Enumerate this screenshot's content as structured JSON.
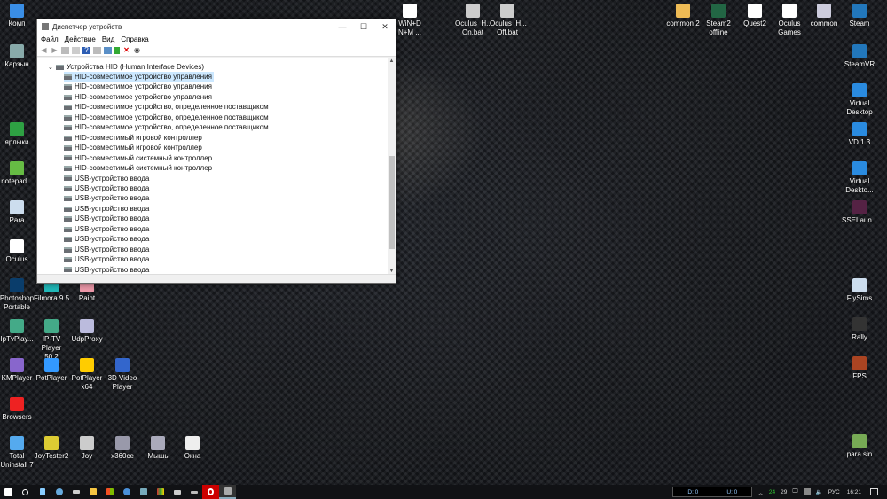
{
  "desktop": {
    "icons": [
      {
        "label": "Комп",
        "color": "#3a8ee6"
      },
      {
        "label": "Карзын",
        "color": "#8aa"
      },
      {
        "label": "ярлыки",
        "color": "#2ea043"
      },
      {
        "label": "notepad...",
        "color": "#6b4"
      },
      {
        "label": "Para",
        "color": "#cde"
      },
      {
        "label": "Oculus",
        "color": "#fff"
      },
      {
        "label": "Photoshop Portable",
        "color": "#0a3d6b"
      },
      {
        "label": "Filmora 9.5",
        "color": "#2bb"
      },
      {
        "label": "Paint",
        "color": "#e9a"
      },
      {
        "label": "IpTvPlay...",
        "color": "#4a8"
      },
      {
        "label": "IP-TV Player 50.2",
        "color": "#4a8"
      },
      {
        "label": "UdpProxy",
        "color": "#bbd"
      },
      {
        "label": "KMPlayer",
        "color": "#86c"
      },
      {
        "label": "PotPlayer",
        "color": "#39f"
      },
      {
        "label": "PotPlayer x64",
        "color": "#fc0"
      },
      {
        "label": "3D Video Player",
        "color": "#36c"
      },
      {
        "label": "Browsers",
        "color": "#e22"
      },
      {
        "label": "Total Uninstall 7",
        "color": "#5ae"
      },
      {
        "label": "JoyTester2",
        "color": "#dc3"
      },
      {
        "label": "Joy",
        "color": "#ccc"
      },
      {
        "label": "x360ce",
        "color": "#99a"
      },
      {
        "label": "Мышь",
        "color": "#aab"
      },
      {
        "label": "Окна",
        "color": "#eee"
      },
      {
        "label": "WiN+D N+M ...",
        "color": "#fff"
      },
      {
        "label": "Oculus_H... On.bat",
        "color": "#ccc"
      },
      {
        "label": "Oculus_H... Off.bat",
        "color": "#ccc"
      },
      {
        "label": "common 2",
        "color": "#eb5"
      },
      {
        "label": "Steam2 offline",
        "color": "#264"
      },
      {
        "label": "Quest2",
        "color": "#fff"
      },
      {
        "label": "Oculus Games",
        "color": "#fff"
      },
      {
        "label": "common",
        "color": "#ccd"
      },
      {
        "label": "Steam",
        "color": "#27b"
      },
      {
        "label": "SteamVR",
        "color": "#27b"
      },
      {
        "label": "Virtual Desktop",
        "color": "#2a8be0"
      },
      {
        "label": "VD 1.3",
        "color": "#2a8be0"
      },
      {
        "label": "Virtual Deskto...",
        "color": "#2a8be0"
      },
      {
        "label": "SSELaun...",
        "color": "#524"
      },
      {
        "label": "FlySims",
        "color": "#cde"
      },
      {
        "label": "Rally",
        "color": "#333"
      },
      {
        "label": "FPS",
        "color": "#a42"
      },
      {
        "label": "para.sin",
        "color": "#7a5"
      }
    ]
  },
  "window": {
    "title": "Диспетчер устройств",
    "controls": {
      "minimize": "—",
      "maximize": "☐",
      "close": "✕"
    },
    "menu": [
      "Файл",
      "Действие",
      "Вид",
      "Справка"
    ],
    "tree": {
      "category": "Устройства HID (Human Interface Devices)",
      "items": [
        "HID-совместимое устройство управления",
        "HID-совместимое устройство управления",
        "HID-совместимое устройство управления",
        "HID-совместимое устройство, определенное поставщиком",
        "HID-совместимое устройство, определенное поставщиком",
        "HID-совместимое устройство, определенное поставщиком",
        "HID-совместимый игровой контроллер",
        "HID-совместимый игровой контроллер",
        "HID-совместимый системный контроллер",
        "HID-совместимый системный контроллер",
        "USB-устройство ввода",
        "USB-устройство ввода",
        "USB-устройство ввода",
        "USB-устройство ввода",
        "USB-устройство ввода",
        "USB-устройство ввода",
        "USB-устройство ввода",
        "USB-устройство ввода",
        "USB-устройство ввода",
        "USB-устройство ввода"
      ],
      "selected_index": 0
    }
  },
  "taskbar": {
    "net_down": "D: 0",
    "net_up": "U: 0",
    "temp1": "24",
    "temp2": "29",
    "lang": "РУС",
    "time": "16:21"
  }
}
